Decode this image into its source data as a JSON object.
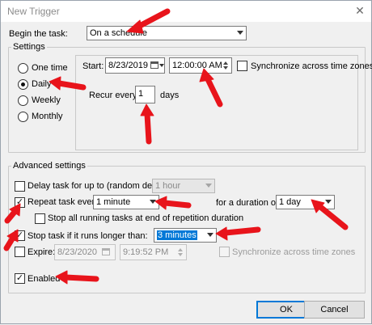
{
  "window": {
    "title": "New Trigger",
    "close_glyph": "✕"
  },
  "begin": {
    "label": "Begin the task:",
    "value": "On a schedule"
  },
  "settings": {
    "legend": "Settings",
    "schedule_options": [
      "One time",
      "Daily",
      "Weekly",
      "Monthly"
    ],
    "selected": "Daily",
    "start_label": "Start:",
    "start_date": "8/23/2019",
    "start_time": "12:00:00 AM",
    "sync_label": "Synchronize across time zones",
    "recur_label": "Recur every:",
    "recur_value": "1",
    "recur_unit": "days"
  },
  "advanced": {
    "legend": "Advanced settings",
    "delay_label": "Delay task for up to (random delay):",
    "delay_value": "1 hour",
    "delay_checked": false,
    "repeat_label": "Repeat task every:",
    "repeat_value": "1 minute",
    "repeat_checked": true,
    "duration_label": "for a duration of:",
    "duration_value": "1 day",
    "stop_all_label": "Stop all running tasks at end of repetition duration",
    "stop_all_checked": false,
    "stop_longer_label": "Stop task if it runs longer than:",
    "stop_longer_value": "3 minutes",
    "stop_longer_checked": true,
    "expire_label": "Expire:",
    "expire_date": "8/23/2020",
    "expire_time": "9:19:52 PM",
    "expire_checked": false,
    "expire_sync_label": "Synchronize across time zones",
    "enabled_label": "Enabled",
    "enabled_checked": true
  },
  "buttons": {
    "ok": "OK",
    "cancel": "Cancel"
  },
  "colors": {
    "annotation_arrow": "#e8141b",
    "selection": "#0078d7"
  },
  "check_glyph": "✓"
}
